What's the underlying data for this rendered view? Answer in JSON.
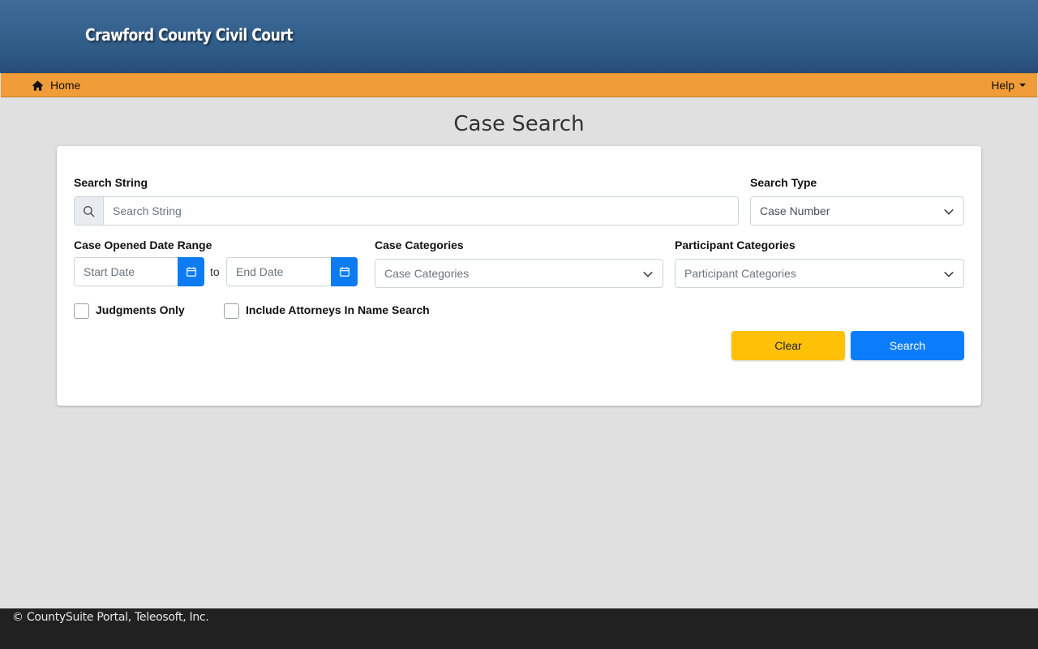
{
  "header": {
    "title": "Crawford County Civil Court"
  },
  "nav": {
    "home_label": "Home",
    "help_label": "Help",
    "home_icon": "home-icon",
    "help_icon": "caret-down-icon"
  },
  "page": {
    "title": "Case Search"
  },
  "form": {
    "search_string": {
      "label": "Search String",
      "placeholder": "Search String",
      "icon": "search-icon"
    },
    "search_type": {
      "label": "Search Type",
      "value": "Case Number"
    },
    "date_range": {
      "label": "Case Opened Date Range",
      "start_placeholder": "Start Date",
      "end_placeholder": "End Date",
      "separator": "to",
      "icon": "calendar-icon"
    },
    "case_categories": {
      "label": "Case Categories",
      "placeholder": "Case Categories"
    },
    "participant_categories": {
      "label": "Participant Categories",
      "placeholder": "Participant Categories"
    },
    "judgments_only": {
      "label": "Judgments Only",
      "checked": false
    },
    "include_attorneys": {
      "label": "Include Attorneys In Name Search",
      "checked": false
    },
    "clear_label": "Clear",
    "search_label": "Search"
  },
  "footer": {
    "text": "© CountySuite Portal, Teleosoft, Inc."
  },
  "colors": {
    "banner": "#2e5a86",
    "nav": "#f09c38",
    "clear": "#ffc107",
    "search": "#0b7dfa",
    "footer": "#212121"
  }
}
